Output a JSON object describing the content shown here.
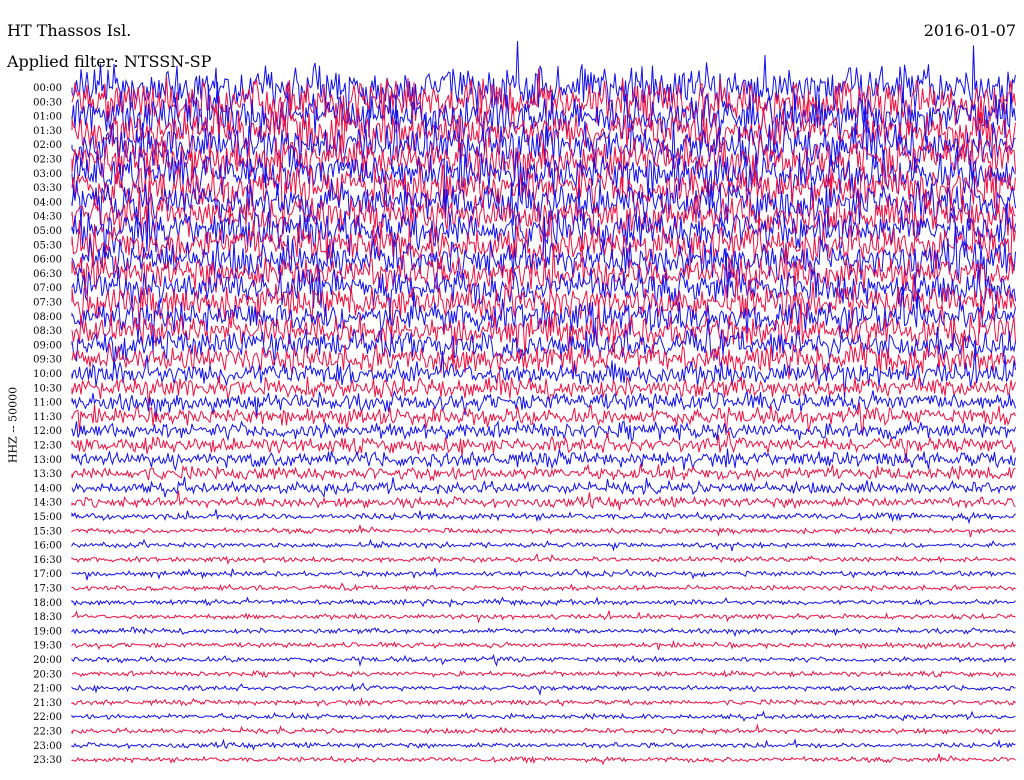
{
  "header": {
    "station": "HT Thassos Isl.",
    "date": "2016-01-07",
    "filter": "Applied filter: NTSSN-SP"
  },
  "chart_data": {
    "type": "line",
    "title": "HT Thassos Isl.",
    "subtitle": "Applied filter: NTSSN-SP",
    "date": "2016-01-07",
    "ylabel": "HHZ -- 50000",
    "xlabel": "",
    "grid": false,
    "legend": "none",
    "trace_colors": [
      "#1010ee",
      "#f01040"
    ],
    "rows": [
      "00:00",
      "00:30",
      "01:00",
      "01:30",
      "02:00",
      "02:30",
      "03:00",
      "03:30",
      "04:00",
      "04:30",
      "05:00",
      "05:30",
      "06:00",
      "06:30",
      "07:00",
      "07:30",
      "08:00",
      "08:30",
      "09:00",
      "09:30",
      "10:00",
      "10:30",
      "11:00",
      "11:30",
      "12:00",
      "12:30",
      "13:00",
      "13:30",
      "14:00",
      "14:30",
      "15:00",
      "15:30",
      "16:00",
      "16:30",
      "17:00",
      "17:30",
      "18:00",
      "18:30",
      "19:00",
      "19:30",
      "20:00",
      "20:30",
      "21:00",
      "21:30",
      "22:00",
      "22:30",
      "23:00",
      "23:30"
    ],
    "series": [
      {
        "values": [
          26,
          26,
          25,
          25,
          25,
          25,
          24,
          24,
          24,
          23,
          23,
          22,
          22,
          21,
          21,
          20,
          19,
          18,
          17,
          16,
          14,
          12,
          11,
          10,
          10,
          9,
          9,
          8,
          7,
          6,
          4,
          3,
          3,
          3,
          3,
          3,
          3,
          3,
          3,
          3,
          3,
          3,
          3,
          3,
          3,
          3,
          3,
          3
        ]
      }
    ],
    "amplitude_unit": "relative trace amplitude"
  }
}
